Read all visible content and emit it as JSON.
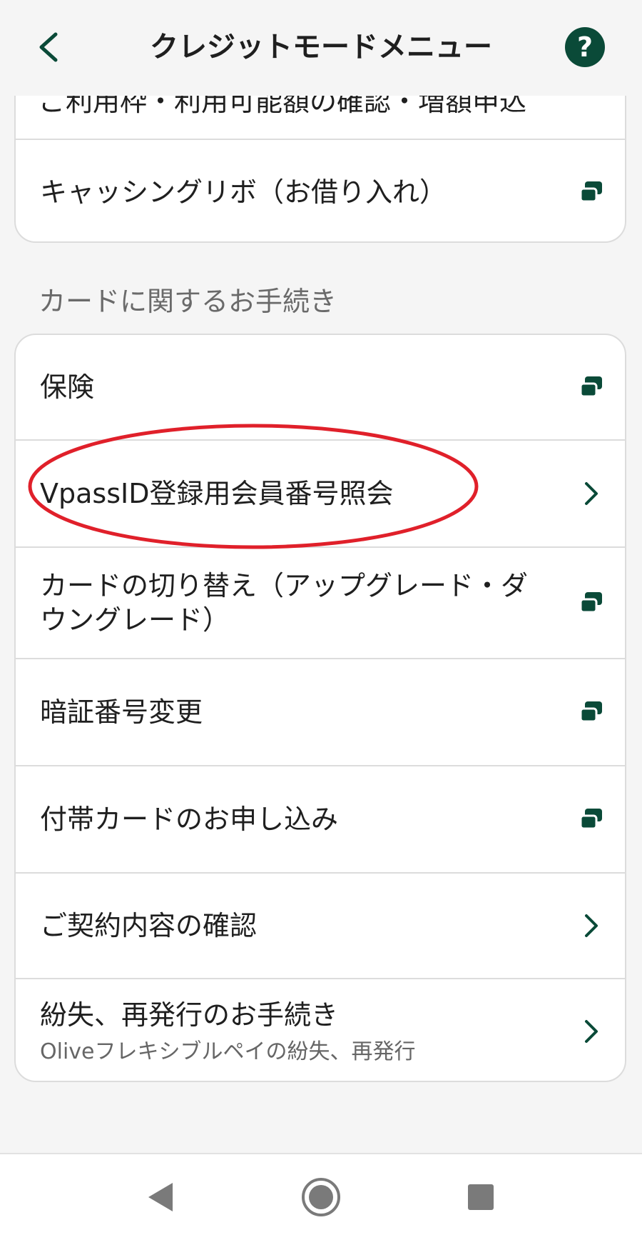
{
  "header": {
    "title": "クレジットモードメニュー",
    "help_label": "?"
  },
  "top_card": {
    "cut_text": "ご利用枠・利用可能額の確認・増額申込",
    "items": [
      {
        "label": "キャッシングリボ（お借り入れ）",
        "icon": "external-link-icon"
      }
    ]
  },
  "section": {
    "title": "カードに関するお手続き"
  },
  "items": [
    {
      "label": "保険",
      "icon": "external-link-icon"
    },
    {
      "label": "VpassID登録用会員番号照会",
      "icon": "chevron-right-icon",
      "highlighted": true
    },
    {
      "label": "カードの切り替え（アップグレード・ダウングレード）",
      "icon": "external-link-icon"
    },
    {
      "label": "暗証番号変更",
      "icon": "external-link-icon"
    },
    {
      "label": "付帯カードのお申し込み",
      "icon": "external-link-icon"
    },
    {
      "label": "ご契約内容の確認",
      "icon": "chevron-right-icon"
    },
    {
      "label": "紛失、再発行のお手続き",
      "sublabel": "Oliveフレキシブルペイの紛失、再発行",
      "icon": "chevron-right-icon"
    }
  ],
  "colors": {
    "accent": "#0a4a38",
    "highlight": "#e0202a"
  },
  "navbar": {
    "icons": [
      "back-triangle-icon",
      "home-circle-icon",
      "recents-square-icon"
    ]
  }
}
